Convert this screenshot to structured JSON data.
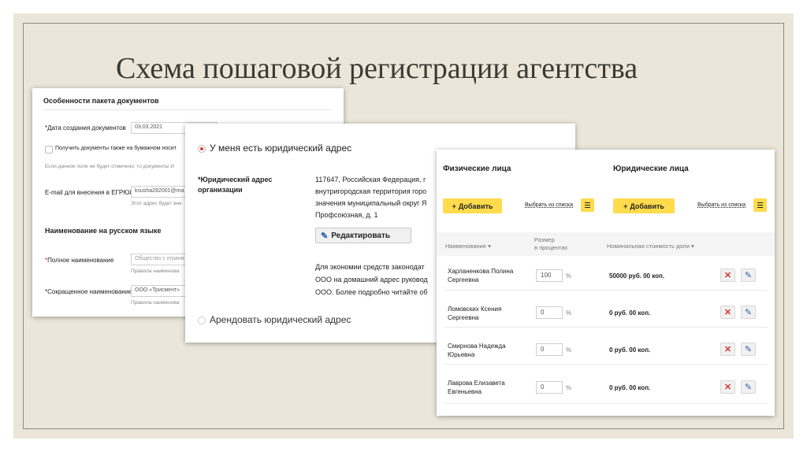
{
  "slide_title": "Схема пошаговой регистрации агентства",
  "panel1": {
    "heading": "Особенности пакета документов",
    "date_label": "*Дата создания документов",
    "date_value": "03.03.2021",
    "paper_copy_label": "Получить документы также на бумажном носит",
    "paper_copy_hint": "Если данное поле не будет отмечено, то документы И",
    "email_label": "E-mail для внесения в ЕГРЮЛ",
    "email_value": "ksusha282001@ma",
    "email_hint": "Этот адрес будет вне",
    "names_heading": "Наименование на русском языке",
    "full_name_label": "*Полное наименование",
    "full_name_placeholder": "Общество с ограни",
    "full_name_rules": "Правила наименова",
    "short_name_label": "*Сокращенное наименование",
    "short_name_value": "ООО «Трисмент»",
    "short_name_rules": "Правила наименова"
  },
  "panel2": {
    "own_address_option": "У меня есть юридический адрес",
    "address_label_line1": "*Юридический адрес",
    "address_label_line2": "организации",
    "address_lines": [
      "117647, Российская Федерация, г",
      "внутригородская территория горо",
      "значения муниципальный округ Я",
      "Профсоюзная, д. 1"
    ],
    "edit_button": "Редактировать",
    "note_lines": [
      "Для экономии средств законодат",
      "ООО на домашний адрес руковод",
      "ООО. Более подробно читайте об"
    ],
    "rent_address_option": "Арендовать юридический адрес"
  },
  "panel3": {
    "individuals_title": "Физические лица",
    "legal_entities_title": "Юридические лица",
    "add_button": "Добавить",
    "choose_from_list": "Выбрать из списка",
    "col_name": "Наименование",
    "col_size_line1": "Размер",
    "col_size_line2": "в процентах",
    "col_nominal": "Номинальная стоимость доли",
    "percent_sign": "%",
    "rows": [
      {
        "name_line1": "Харланенкова Полина",
        "name_line2": "Сергеевна",
        "percent": "100",
        "amount": "50000 руб. 00 коп."
      },
      {
        "name_line1": "Ломовских Ксения",
        "name_line2": "Сергеевна",
        "percent": "0",
        "amount": "0 руб. 00 коп."
      },
      {
        "name_line1": "Смирнова Надежда",
        "name_line2": "Юрьевна",
        "percent": "0",
        "amount": "0 руб. 00 коп."
      },
      {
        "name_line1": "Лаврова Елизавета",
        "name_line2": "Евгеньевна",
        "percent": "0",
        "amount": "0 руб. 00 коп."
      }
    ]
  },
  "colors": {
    "slide_background": "#ebe6d9",
    "accent_yellow": "#ffdb4d",
    "required_red": "#d22",
    "radio_selected": "#e23b2e",
    "link_blue": "#2f62b0"
  },
  "icons": [
    "radio-selected-icon",
    "radio-unselected-icon",
    "pencil-icon",
    "plus-icon",
    "menu-icon",
    "delete-icon",
    "sort-icon"
  ]
}
